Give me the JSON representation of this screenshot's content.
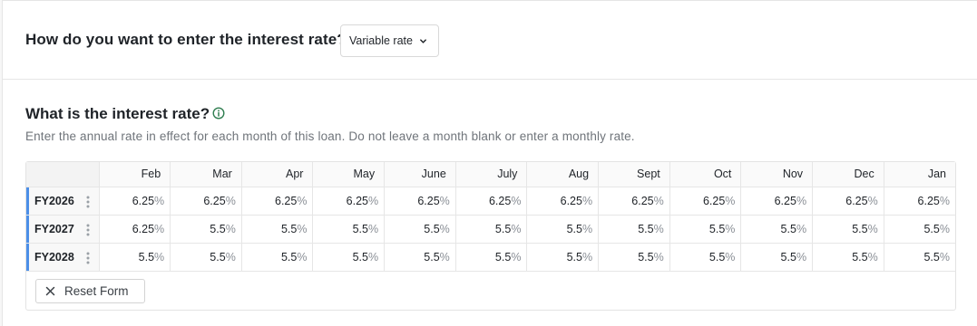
{
  "entry_question": "How do you want to enter the interest rate?",
  "rate_type_select": {
    "value": "Variable rate"
  },
  "rate_question": "What is the interest rate?",
  "rate_help": "Enter the annual rate in effect for each month of this loan. Do not leave a month blank or enter a monthly rate.",
  "grid": {
    "months": [
      "Feb",
      "Mar",
      "Apr",
      "May",
      "June",
      "July",
      "Aug",
      "Sept",
      "Oct",
      "Nov",
      "Dec",
      "Jan"
    ],
    "percent_symbol": "%",
    "rows": [
      {
        "label": "FY2026",
        "values": [
          "6.25",
          "6.25",
          "6.25",
          "6.25",
          "6.25",
          "6.25",
          "6.25",
          "6.25",
          "6.25",
          "6.25",
          "6.25",
          "6.25"
        ]
      },
      {
        "label": "FY2027",
        "values": [
          "6.25",
          "5.5",
          "5.5",
          "5.5",
          "5.5",
          "5.5",
          "5.5",
          "5.5",
          "5.5",
          "5.5",
          "5.5",
          "5.5"
        ]
      },
      {
        "label": "FY2028",
        "values": [
          "5.5",
          "5.5",
          "5.5",
          "5.5",
          "5.5",
          "5.5",
          "5.5",
          "5.5",
          "5.5",
          "5.5",
          "5.5",
          "5.5"
        ]
      }
    ]
  },
  "reset_button": {
    "label": "Reset Form"
  },
  "colors": {
    "row_accent": "#4c8fe8",
    "info_icon": "#2e7d4f"
  },
  "icons": {
    "select": "chevron-down-icon",
    "info": "info-icon",
    "row_menu": "kebab-menu-icon",
    "reset": "close-icon"
  }
}
